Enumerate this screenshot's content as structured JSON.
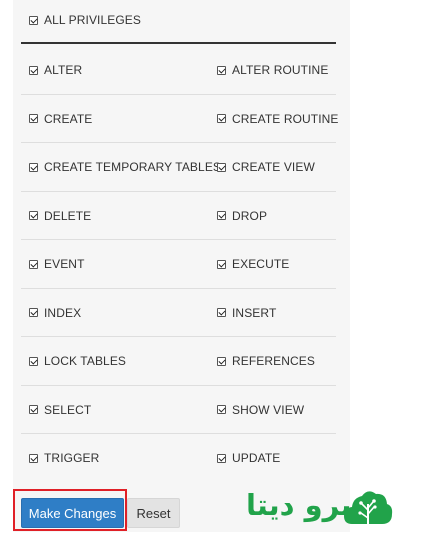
{
  "all_privileges_label": "ALL PRIVILEGES",
  "privileges": [
    [
      "ALTER",
      "ALTER ROUTINE"
    ],
    [
      "CREATE",
      "CREATE ROUTINE"
    ],
    [
      "CREATE TEMPORARY TABLES",
      "CREATE VIEW"
    ],
    [
      "DELETE",
      "DROP"
    ],
    [
      "EVENT",
      "EXECUTE"
    ],
    [
      "INDEX",
      "INSERT"
    ],
    [
      "LOCK TABLES",
      "REFERENCES"
    ],
    [
      "SELECT",
      "SHOW VIEW"
    ],
    [
      "TRIGGER",
      "UPDATE"
    ]
  ],
  "all_checked": true,
  "buttons": {
    "make_changes": "Make Changes",
    "reset": "Reset"
  },
  "logo": {
    "text": "سرو دیتا",
    "color": "#21a34a"
  },
  "colors": {
    "primary_button": "#2f7ec6",
    "highlight_border": "#e02027"
  }
}
